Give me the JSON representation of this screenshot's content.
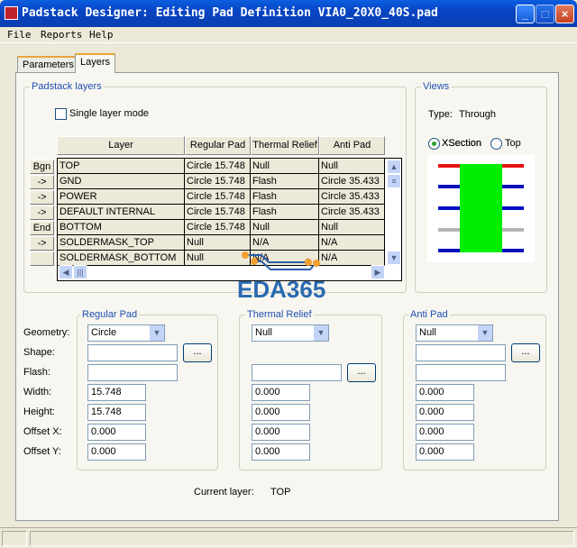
{
  "window": {
    "title": "Padstack Designer: Editing Pad Definition VIA0_20X0_40S.pad"
  },
  "menu": [
    "File",
    "Reports",
    "Help"
  ],
  "tabs": [
    "Parameters",
    "Layers"
  ],
  "padstack_layers": {
    "title": "Padstack layers",
    "single_layer_mode": "Single layer mode",
    "single_layer_checked": false,
    "columns": [
      "Layer",
      "Regular Pad",
      "Thermal Relief",
      "Anti Pad"
    ],
    "rows": [
      {
        "btn": "Bgn",
        "cells": [
          "TOP",
          "Circle 15.748",
          "Null",
          "Null"
        ]
      },
      {
        "btn": "->",
        "cells": [
          "GND",
          "Circle 15.748",
          "Flash",
          "Circle 35.433"
        ]
      },
      {
        "btn": "->",
        "cells": [
          "POWER",
          "Circle 15.748",
          "Flash",
          "Circle 35.433"
        ]
      },
      {
        "btn": "->",
        "cells": [
          "DEFAULT INTERNAL",
          "Circle 15.748",
          "Flash",
          "Circle 35.433"
        ]
      },
      {
        "btn": "End",
        "cells": [
          "BOTTOM",
          "Circle 15.748",
          "Null",
          "Null"
        ]
      },
      {
        "btn": "->",
        "cells": [
          "SOLDERMASK_TOP",
          "Null",
          "N/A",
          "N/A"
        ]
      },
      {
        "btn": "",
        "cells": [
          "SOLDERMASK_BOTTOM",
          "Null",
          "N/A",
          "N/A"
        ]
      }
    ]
  },
  "views": {
    "title": "Views",
    "type_label": "Type:",
    "type_value": "Through",
    "xsection": "XSection",
    "top": "Top",
    "selected": "XSection",
    "colors": {
      "top": "#e81010",
      "inner": "#0010c0",
      "default": "#b4b4b4",
      "bottom": "#0010c0",
      "drill": "#00ee00"
    }
  },
  "watermark": "EDA365",
  "field_labels": {
    "geometry": "Geometry:",
    "shape": "Shape:",
    "flash": "Flash:",
    "width": "Width:",
    "height": "Height:",
    "offset_x": "Offset X:",
    "offset_y": "Offset Y:"
  },
  "regular_pad": {
    "title": "Regular Pad",
    "geometry": "Circle",
    "shape": "",
    "flash": "",
    "width": "15.748",
    "height": "15.748",
    "offset_x": "0.000",
    "offset_y": "0.000"
  },
  "thermal_relief": {
    "title": "Thermal Relief",
    "geometry": "Null",
    "flash": "",
    "width": "0.000",
    "height": "0.000",
    "offset_x": "0.000",
    "offset_y": "0.000"
  },
  "anti_pad": {
    "title": "Anti Pad",
    "geometry": "Null",
    "shape": "",
    "flash": "",
    "width": "0.000",
    "height": "0.000",
    "offset_x": "0.000",
    "offset_y": "0.000"
  },
  "browse_label": "...",
  "current_layer": {
    "label": "Current layer:",
    "value": "TOP"
  }
}
